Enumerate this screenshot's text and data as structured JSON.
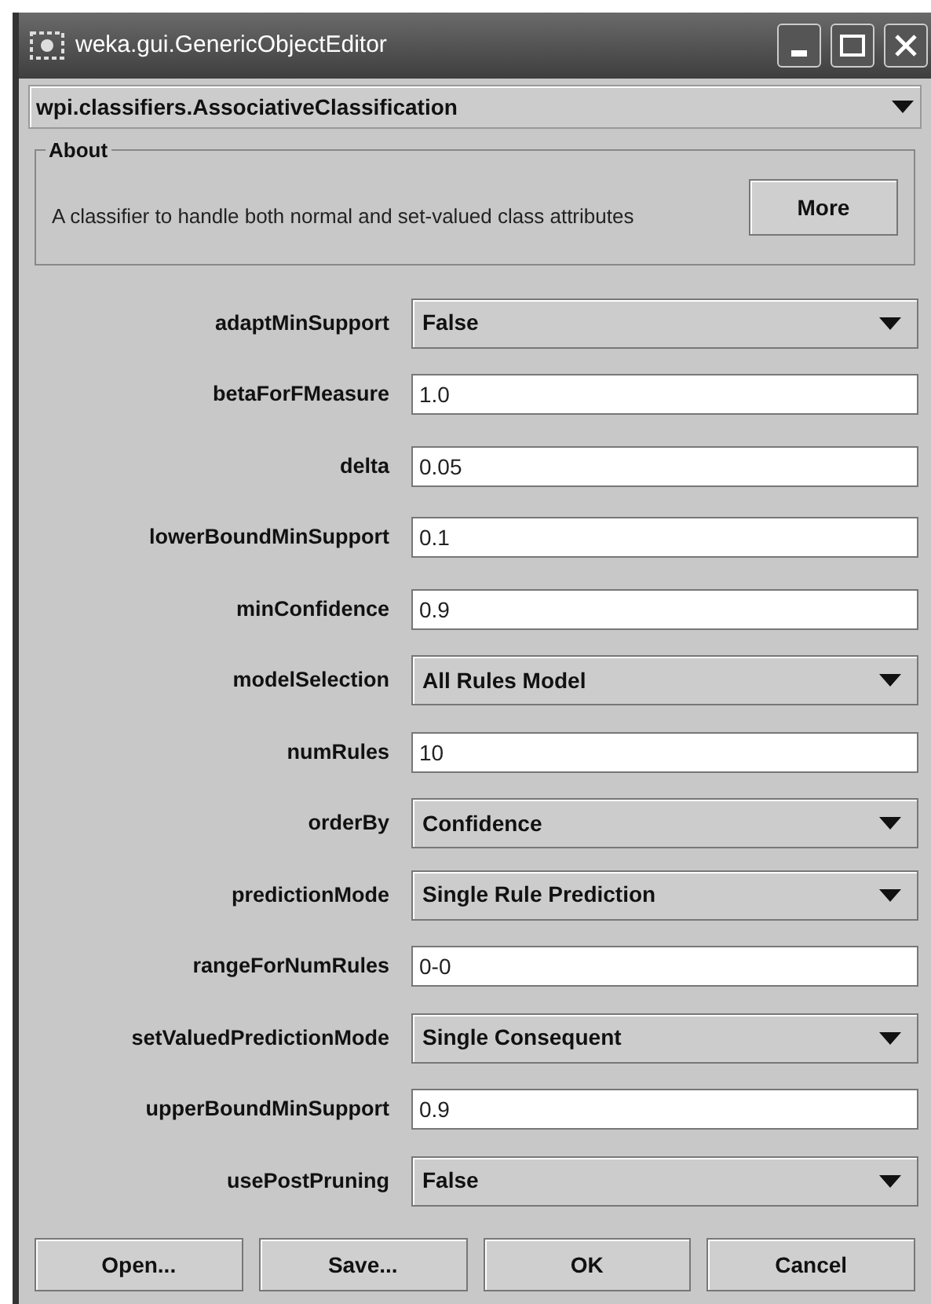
{
  "window": {
    "title": "weka.gui.GenericObjectEditor"
  },
  "class_selector": {
    "value": "wpi.classifiers.AssociativeClassification"
  },
  "about": {
    "title": "About",
    "description": "A classifier to handle both normal and set-valued class attributes",
    "button": "More"
  },
  "properties": [
    {
      "label": "adaptMinSupport",
      "kind": "choice",
      "value": "False"
    },
    {
      "label": "betaForFMeasure",
      "kind": "text",
      "value": "1.0"
    },
    {
      "label": "delta",
      "kind": "text",
      "value": "0.05"
    },
    {
      "label": "lowerBoundMinSupport",
      "kind": "text",
      "value": "0.1"
    },
    {
      "label": "minConfidence",
      "kind": "text",
      "value": "0.9"
    },
    {
      "label": "modelSelection",
      "kind": "choice",
      "value": "All Rules Model"
    },
    {
      "label": "numRules",
      "kind": "text",
      "value": "10"
    },
    {
      "label": "orderBy",
      "kind": "choice",
      "value": "Confidence"
    },
    {
      "label": "predictionMode",
      "kind": "choice",
      "value": "Single Rule Prediction"
    },
    {
      "label": "rangeForNumRules",
      "kind": "text",
      "value": "0-0"
    },
    {
      "label": "setValuedPredictionMode",
      "kind": "choice",
      "value": "Single Consequent"
    },
    {
      "label": "upperBoundMinSupport",
      "kind": "text",
      "value": "0.9"
    },
    {
      "label": "usePostPruning",
      "kind": "choice",
      "value": "False"
    }
  ],
  "buttons": [
    "Open...",
    "Save...",
    "OK",
    "Cancel"
  ]
}
